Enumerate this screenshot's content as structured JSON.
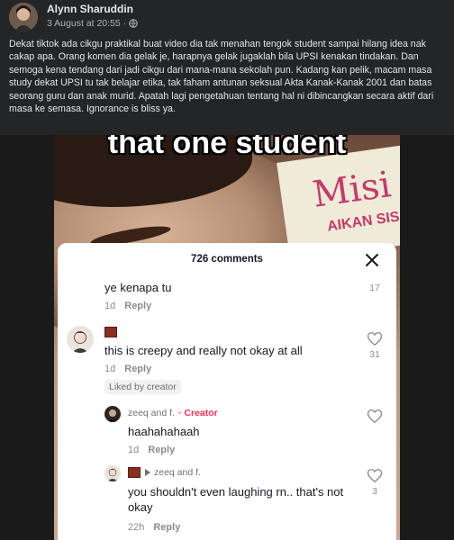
{
  "post": {
    "author": "Alynn Sharuddin",
    "timestamp": "3 August at 20:55 ·",
    "body": "Dekat tiktok ada cikgu praktikal buat video dia tak menahan tengok student sampai hilang idea nak cakap apa. Orang komen dia gelak je, harapnya gelak jugaklah bila UPSI kenakan tindakan. Dan semoga kena tendang dari jadi cikgu dari mana-mana sekolah pun. Kadang kan pelik, macam masa study dekat UPSI tu tak belajar etika, tak faham antunan seksual Akta Kanak-Kanak 2001 dan batas seorang guru dan anak murid. Apatah lagi pengetahuan tentang hal ni dibincangkan secara aktif dari masa ke semasa. Ignorance is bliss ya."
  },
  "video": {
    "caption": "that one student",
    "poster_text": "Misi",
    "poster_text2": "AIKAN SIS"
  },
  "comments_sheet": {
    "title": "726 comments",
    "comments": [
      {
        "text": "ye kenapa tu",
        "age": "1d",
        "reply_label": "Reply",
        "likes": "17"
      },
      {
        "text": "this is creepy and really not okay at all",
        "age": "1d",
        "reply_label": "Reply",
        "likes": "31",
        "badge": "Liked by creator"
      },
      {
        "name": "zeeq and f.",
        "tag": "· Creator",
        "text": "haahahahaah",
        "age": "1d",
        "reply_label": "Reply",
        "likes": ""
      },
      {
        "name": "zeeq and f.",
        "text": "you shouldn't even laughing rn.. that's not okay",
        "age": "22h",
        "reply_label": "Reply",
        "likes": "3"
      }
    ]
  },
  "colors": {
    "creator": "#fe2c55",
    "fb_bg": "#242526"
  }
}
